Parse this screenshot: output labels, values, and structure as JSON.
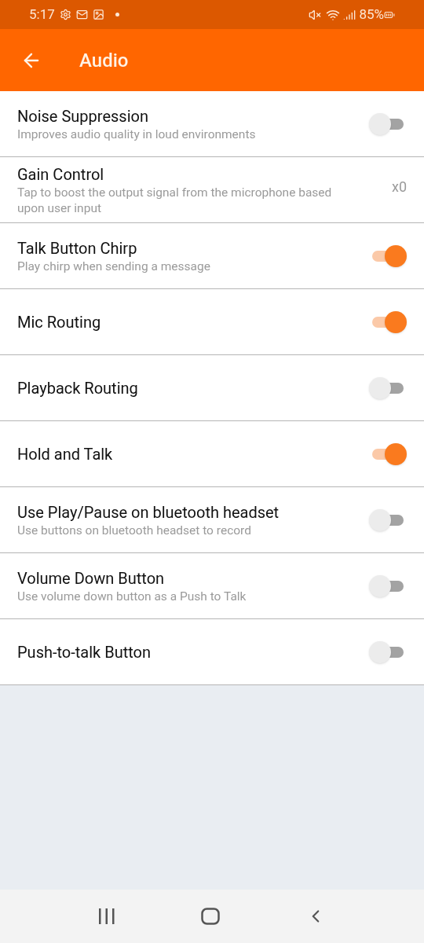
{
  "status_bar": {
    "time": "5:17",
    "battery": "85%"
  },
  "header": {
    "title": "Audio"
  },
  "settings": [
    {
      "kind": "toggle",
      "title": "Noise Suppression",
      "subtitle": "Improves audio quality in loud environments",
      "on": false
    },
    {
      "kind": "value",
      "title": "Gain Control",
      "subtitle": "Tap to boost the output signal from the microphone based upon user input",
      "value": "x0"
    },
    {
      "kind": "toggle",
      "title": "Talk Button Chirp",
      "subtitle": "Play chirp when sending a message",
      "on": true
    },
    {
      "kind": "toggle",
      "title": "Mic Routing",
      "on": true
    },
    {
      "kind": "toggle",
      "title": "Playback Routing",
      "on": false
    },
    {
      "kind": "toggle",
      "title": "Hold and Talk",
      "on": true
    },
    {
      "kind": "toggle",
      "title": "Use Play/Pause on bluetooth headset",
      "subtitle": "Use buttons on bluetooth headset to record",
      "on": false
    },
    {
      "kind": "toggle",
      "title": "Volume Down Button",
      "subtitle": "Use volume down button as a Push to Talk",
      "on": false
    },
    {
      "kind": "toggle",
      "title": "Push-to-talk Button",
      "on": false
    }
  ]
}
